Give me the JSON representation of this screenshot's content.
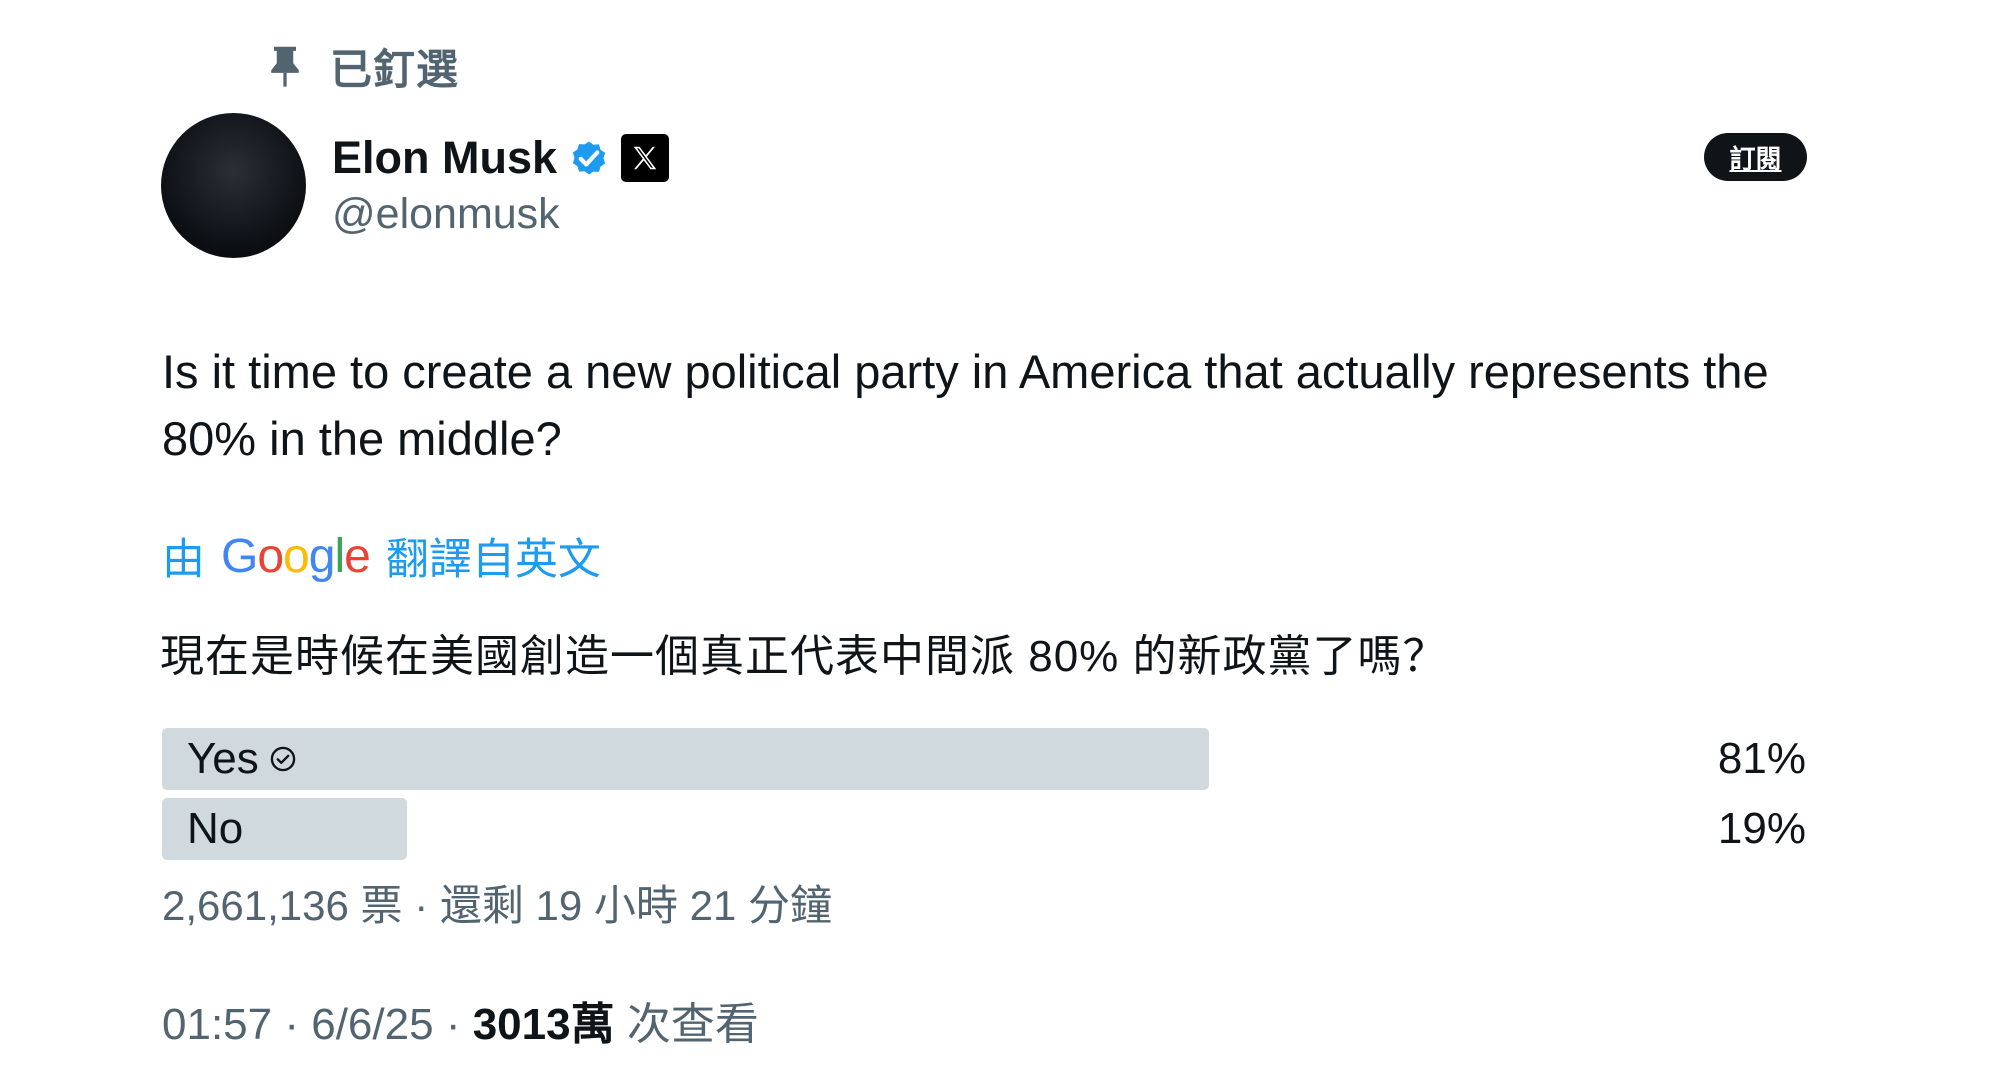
{
  "pinned": {
    "label": "已釘選"
  },
  "author": {
    "name": "Elon Musk",
    "handle": "@elonmusk"
  },
  "subscribe_label": "訂閱",
  "tweet": {
    "text": "Is it time to create a new political party in America that actually represents the 80% in the middle?"
  },
  "translation": {
    "prefix": "由",
    "provider": "Google",
    "suffix": "翻譯自英文",
    "text": "現在是時候在美國創造一個真正代表中間派 80% 的新政黨了嗎？"
  },
  "poll": {
    "options": [
      {
        "label": "Yes",
        "percent": "81%",
        "fraction": 0.81,
        "selected": true
      },
      {
        "label": "No",
        "percent": "19%",
        "fraction": 0.19,
        "selected": false
      }
    ],
    "votes": "2,661,136 票",
    "separator": "·",
    "remaining": "還剩 19 小時 21 分鐘"
  },
  "meta": {
    "time": "01:57",
    "date": "6/6/25",
    "views_count": "3013萬",
    "views_label": "次查看"
  },
  "colors": {
    "accent": "#1d9bf0",
    "secondary_text": "#536471",
    "poll_bar": "#cfd9de",
    "google_blue": "#4285f4",
    "google_red": "#ea4335",
    "google_yellow": "#fbbc05",
    "google_green": "#34a853"
  }
}
